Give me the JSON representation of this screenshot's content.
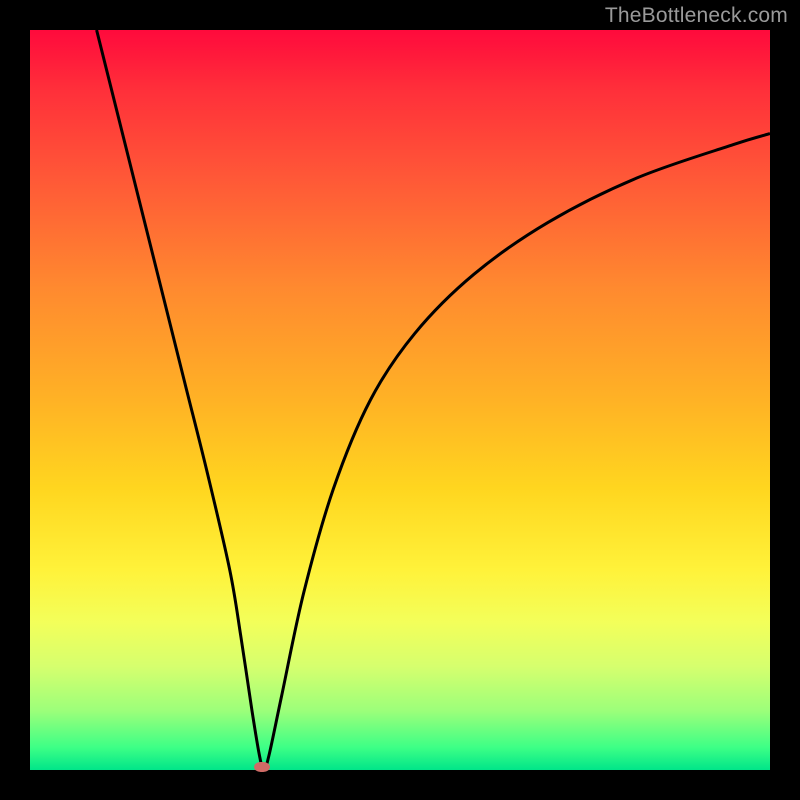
{
  "watermark": "TheBottleneck.com",
  "colors": {
    "gradient_top": "#ff0a3c",
    "gradient_bottom": "#00e589",
    "curve": "#000000",
    "frame": "#000000",
    "marker": "#cf6b66"
  },
  "chart_data": {
    "type": "line",
    "title": "",
    "xlabel": "",
    "ylabel": "",
    "xlim": [
      0,
      100
    ],
    "ylim": [
      0,
      100
    ],
    "x": [
      9,
      12,
      15,
      18,
      21,
      24,
      27,
      28.5,
      30,
      31,
      31.6,
      32.3,
      34,
      37,
      41,
      46,
      52,
      60,
      70,
      82,
      95,
      100
    ],
    "y": [
      100,
      88,
      76,
      64,
      52,
      40,
      27,
      18,
      8,
      2,
      0,
      2,
      10,
      24,
      38,
      50,
      59,
      67,
      74,
      80,
      84.5,
      86
    ],
    "marker": {
      "x": 31.3,
      "y": 0.4
    },
    "gradient_stops": [
      {
        "pos": 0.0,
        "color": "#ff0a3c"
      },
      {
        "pos": 0.5,
        "color": "#ffb225"
      },
      {
        "pos": 0.8,
        "color": "#f3ff5a"
      },
      {
        "pos": 1.0,
        "color": "#00e589"
      }
    ]
  }
}
